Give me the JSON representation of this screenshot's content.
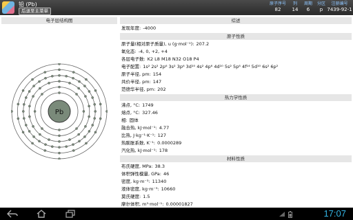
{
  "header": {
    "element_name": "铅 (Pb)",
    "back_label": "后退至主菜单",
    "columns": [
      {
        "label": "原子序号",
        "value": "82"
      },
      {
        "label": "列",
        "value": "14"
      },
      {
        "label": "周期",
        "value": "6"
      },
      {
        "label": "分区",
        "value": "p"
      },
      {
        "label": "注册编号",
        "value": "7439-92-1"
      }
    ]
  },
  "left": {
    "title": "电子层结构图",
    "symbol": "Pb",
    "shells": [
      2,
      8,
      18,
      32,
      18,
      4
    ]
  },
  "sections": [
    {
      "title": "综述",
      "rows": [
        {
          "label": "发现年度:",
          "value": "-4000"
        }
      ]
    },
    {
      "title": "原子性质",
      "rows": [
        {
          "label": "原子量(相对原子质量), u (g·mol⁻¹):",
          "value": "207.2"
        },
        {
          "label": "氧化态:",
          "value": "-4, 0, +2, +4"
        },
        {
          "label": "各层电子数:",
          "value": "K2 L8 M18 N32 O18 P4"
        },
        {
          "label": "电子配置:",
          "value": "1s² 2s² 2p⁶ 3s² 3p⁶ 3d¹⁰ 4s² 4p⁶ 4d¹⁰ 5s² 5p⁶ 4f¹⁴ 5d¹⁰ 6s² 6p²"
        },
        {
          "label": "原子半径, pm:",
          "value": "154"
        },
        {
          "label": "共价半径, pm:",
          "value": "147"
        },
        {
          "label": "范德华半径, pm:",
          "value": "202"
        }
      ]
    },
    {
      "title": "热力学性质",
      "rows": [
        {
          "label": "沸点, °C:",
          "value": "1749"
        },
        {
          "label": "熔点, °C:",
          "value": "327.46"
        },
        {
          "label": "相:",
          "value": "固体"
        },
        {
          "label": "融合热, kJ·mol⁻¹:",
          "value": "4.77"
        },
        {
          "label": "比热, J·kg⁻¹·K⁻¹:",
          "value": "127"
        },
        {
          "label": "热膨胀系数, K⁻¹:",
          "value": "0.0000289"
        },
        {
          "label": "汽化热, kJ·mol⁻¹:",
          "value": "178"
        }
      ]
    },
    {
      "title": "材料性质",
      "rows": [
        {
          "label": "布氏硬度, MPa:",
          "value": "38.3"
        },
        {
          "label": "体积弹性模量, GPa:",
          "value": "46"
        },
        {
          "label": "密度, kg·m⁻³:",
          "value": "11340"
        },
        {
          "label": "液体密度, kg·m⁻³:",
          "value": "10660"
        },
        {
          "label": "莫氏硬度:",
          "value": "1.5"
        },
        {
          "label": "摩尔体积, m³·mol⁻¹:",
          "value": "0.00001827"
        }
      ]
    }
  ],
  "status": {
    "time": "17:07",
    "nav_icons": [
      "back-icon",
      "home-icon",
      "recent-apps-icon"
    ],
    "status_icons": [
      "signal-icon",
      "battery-icon"
    ]
  },
  "colors": {
    "accent": "#33b5e5",
    "nucleus": "#7a8a7a",
    "orbit": "#666666",
    "electron": "#7a8a7a"
  }
}
